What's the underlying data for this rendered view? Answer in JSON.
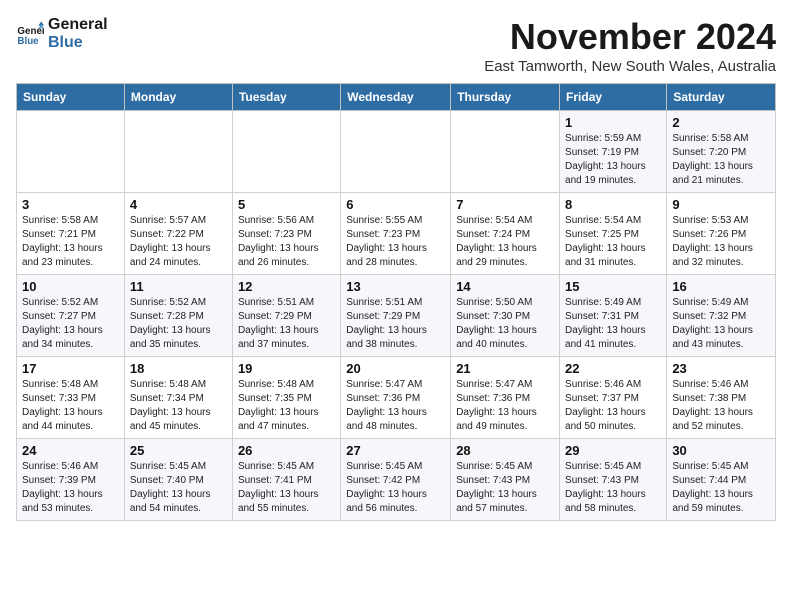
{
  "logo": {
    "line1": "General",
    "line2": "Blue"
  },
  "title": "November 2024",
  "subtitle": "East Tamworth, New South Wales, Australia",
  "days_header": [
    "Sunday",
    "Monday",
    "Tuesday",
    "Wednesday",
    "Thursday",
    "Friday",
    "Saturday"
  ],
  "weeks": [
    [
      {
        "day": "",
        "info": ""
      },
      {
        "day": "",
        "info": ""
      },
      {
        "day": "",
        "info": ""
      },
      {
        "day": "",
        "info": ""
      },
      {
        "day": "",
        "info": ""
      },
      {
        "day": "1",
        "info": "Sunrise: 5:59 AM\nSunset: 7:19 PM\nDaylight: 13 hours\nand 19 minutes."
      },
      {
        "day": "2",
        "info": "Sunrise: 5:58 AM\nSunset: 7:20 PM\nDaylight: 13 hours\nand 21 minutes."
      }
    ],
    [
      {
        "day": "3",
        "info": "Sunrise: 5:58 AM\nSunset: 7:21 PM\nDaylight: 13 hours\nand 23 minutes."
      },
      {
        "day": "4",
        "info": "Sunrise: 5:57 AM\nSunset: 7:22 PM\nDaylight: 13 hours\nand 24 minutes."
      },
      {
        "day": "5",
        "info": "Sunrise: 5:56 AM\nSunset: 7:23 PM\nDaylight: 13 hours\nand 26 minutes."
      },
      {
        "day": "6",
        "info": "Sunrise: 5:55 AM\nSunset: 7:23 PM\nDaylight: 13 hours\nand 28 minutes."
      },
      {
        "day": "7",
        "info": "Sunrise: 5:54 AM\nSunset: 7:24 PM\nDaylight: 13 hours\nand 29 minutes."
      },
      {
        "day": "8",
        "info": "Sunrise: 5:54 AM\nSunset: 7:25 PM\nDaylight: 13 hours\nand 31 minutes."
      },
      {
        "day": "9",
        "info": "Sunrise: 5:53 AM\nSunset: 7:26 PM\nDaylight: 13 hours\nand 32 minutes."
      }
    ],
    [
      {
        "day": "10",
        "info": "Sunrise: 5:52 AM\nSunset: 7:27 PM\nDaylight: 13 hours\nand 34 minutes."
      },
      {
        "day": "11",
        "info": "Sunrise: 5:52 AM\nSunset: 7:28 PM\nDaylight: 13 hours\nand 35 minutes."
      },
      {
        "day": "12",
        "info": "Sunrise: 5:51 AM\nSunset: 7:29 PM\nDaylight: 13 hours\nand 37 minutes."
      },
      {
        "day": "13",
        "info": "Sunrise: 5:51 AM\nSunset: 7:29 PM\nDaylight: 13 hours\nand 38 minutes."
      },
      {
        "day": "14",
        "info": "Sunrise: 5:50 AM\nSunset: 7:30 PM\nDaylight: 13 hours\nand 40 minutes."
      },
      {
        "day": "15",
        "info": "Sunrise: 5:49 AM\nSunset: 7:31 PM\nDaylight: 13 hours\nand 41 minutes."
      },
      {
        "day": "16",
        "info": "Sunrise: 5:49 AM\nSunset: 7:32 PM\nDaylight: 13 hours\nand 43 minutes."
      }
    ],
    [
      {
        "day": "17",
        "info": "Sunrise: 5:48 AM\nSunset: 7:33 PM\nDaylight: 13 hours\nand 44 minutes."
      },
      {
        "day": "18",
        "info": "Sunrise: 5:48 AM\nSunset: 7:34 PM\nDaylight: 13 hours\nand 45 minutes."
      },
      {
        "day": "19",
        "info": "Sunrise: 5:48 AM\nSunset: 7:35 PM\nDaylight: 13 hours\nand 47 minutes."
      },
      {
        "day": "20",
        "info": "Sunrise: 5:47 AM\nSunset: 7:36 PM\nDaylight: 13 hours\nand 48 minutes."
      },
      {
        "day": "21",
        "info": "Sunrise: 5:47 AM\nSunset: 7:36 PM\nDaylight: 13 hours\nand 49 minutes."
      },
      {
        "day": "22",
        "info": "Sunrise: 5:46 AM\nSunset: 7:37 PM\nDaylight: 13 hours\nand 50 minutes."
      },
      {
        "day": "23",
        "info": "Sunrise: 5:46 AM\nSunset: 7:38 PM\nDaylight: 13 hours\nand 52 minutes."
      }
    ],
    [
      {
        "day": "24",
        "info": "Sunrise: 5:46 AM\nSunset: 7:39 PM\nDaylight: 13 hours\nand 53 minutes."
      },
      {
        "day": "25",
        "info": "Sunrise: 5:45 AM\nSunset: 7:40 PM\nDaylight: 13 hours\nand 54 minutes."
      },
      {
        "day": "26",
        "info": "Sunrise: 5:45 AM\nSunset: 7:41 PM\nDaylight: 13 hours\nand 55 minutes."
      },
      {
        "day": "27",
        "info": "Sunrise: 5:45 AM\nSunset: 7:42 PM\nDaylight: 13 hours\nand 56 minutes."
      },
      {
        "day": "28",
        "info": "Sunrise: 5:45 AM\nSunset: 7:43 PM\nDaylight: 13 hours\nand 57 minutes."
      },
      {
        "day": "29",
        "info": "Sunrise: 5:45 AM\nSunset: 7:43 PM\nDaylight: 13 hours\nand 58 minutes."
      },
      {
        "day": "30",
        "info": "Sunrise: 5:45 AM\nSunset: 7:44 PM\nDaylight: 13 hours\nand 59 minutes."
      }
    ]
  ]
}
